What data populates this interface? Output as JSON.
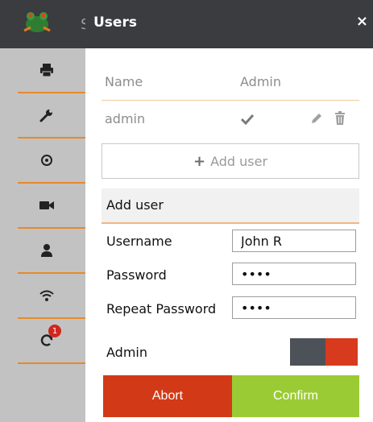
{
  "sidebar": {
    "brand_letter": "S",
    "items": [
      {
        "icon": "printer-icon"
      },
      {
        "icon": "wrench-icon"
      },
      {
        "icon": "gear-icon"
      },
      {
        "icon": "video-camera-icon"
      },
      {
        "icon": "user-icon"
      },
      {
        "icon": "wifi-icon"
      },
      {
        "icon": "refresh-icon",
        "badge": "1"
      }
    ]
  },
  "dialog": {
    "title": "Users",
    "close_label": "×",
    "table": {
      "headers": [
        "Name",
        "Admin"
      ],
      "rows": [
        {
          "name": "admin",
          "admin": true
        }
      ]
    },
    "add_user_button": "Add user",
    "form": {
      "section_title": "Add user",
      "username_label": "Username",
      "username_value": "John R",
      "password_label": "Password",
      "password_value": "abcd",
      "repeat_label": "Repeat Password",
      "repeat_value": "abcd",
      "admin_label": "Admin"
    },
    "abort_label": "Abort",
    "confirm_label": "Confirm"
  },
  "colors": {
    "header_dark": "#3a3c3f",
    "accent_orange": "#e8892a",
    "abort_red": "#d23a17",
    "confirm_green": "#9bcb34",
    "toggle_on": "#d83a1d",
    "toggle_off": "#4d5259",
    "badge_red": "#d0261d"
  }
}
